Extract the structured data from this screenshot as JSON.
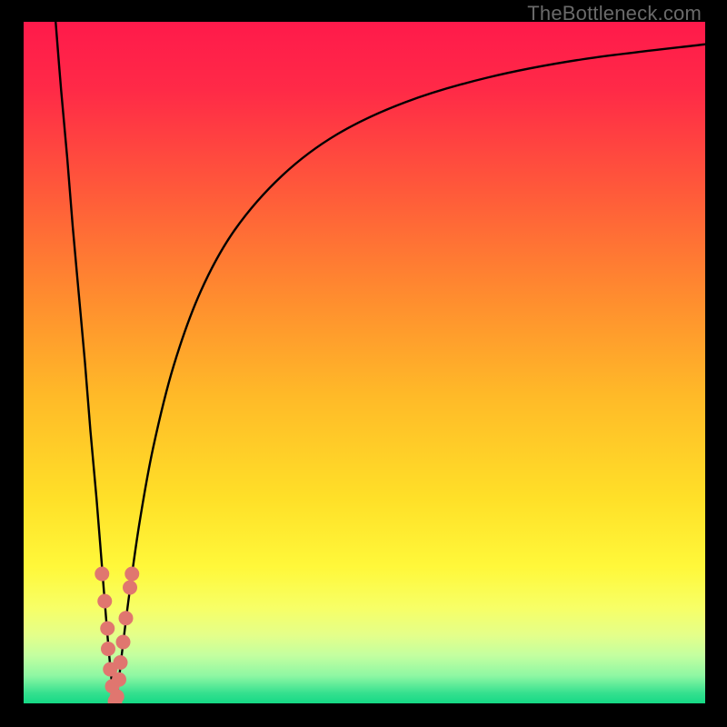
{
  "watermark": "TheBottleneck.com",
  "colors": {
    "frame": "#000000",
    "watermark": "#6a6a6a",
    "curve": "#000000",
    "dots": "#e0766f",
    "gradient_stops": [
      {
        "offset": 0.0,
        "color": "#ff1a4b"
      },
      {
        "offset": 0.1,
        "color": "#ff2a47"
      },
      {
        "offset": 0.25,
        "color": "#ff5a3a"
      },
      {
        "offset": 0.4,
        "color": "#ff8b2f"
      },
      {
        "offset": 0.55,
        "color": "#ffba28"
      },
      {
        "offset": 0.7,
        "color": "#ffe028"
      },
      {
        "offset": 0.8,
        "color": "#fff83a"
      },
      {
        "offset": 0.86,
        "color": "#f7ff66"
      },
      {
        "offset": 0.9,
        "color": "#e4ff8a"
      },
      {
        "offset": 0.93,
        "color": "#c3ffa0"
      },
      {
        "offset": 0.96,
        "color": "#8df7a3"
      },
      {
        "offset": 0.985,
        "color": "#35e08f"
      },
      {
        "offset": 1.0,
        "color": "#15d985"
      }
    ]
  },
  "chart_data": {
    "type": "line",
    "title": "",
    "xlabel": "",
    "ylabel": "",
    "xlim": [
      0,
      100
    ],
    "ylim": [
      0,
      100
    ],
    "curve_points": [
      {
        "x": 4.7,
        "y": 100.0
      },
      {
        "x": 5.5,
        "y": 90.0
      },
      {
        "x": 6.4,
        "y": 80.0
      },
      {
        "x": 7.2,
        "y": 70.0
      },
      {
        "x": 8.1,
        "y": 60.0
      },
      {
        "x": 9.0,
        "y": 50.0
      },
      {
        "x": 9.8,
        "y": 40.0
      },
      {
        "x": 10.7,
        "y": 30.0
      },
      {
        "x": 11.5,
        "y": 20.0
      },
      {
        "x": 12.3,
        "y": 10.0
      },
      {
        "x": 13.0,
        "y": 2.5
      },
      {
        "x": 13.4,
        "y": 0.2
      },
      {
        "x": 13.8,
        "y": 2.0
      },
      {
        "x": 14.5,
        "y": 8.0
      },
      {
        "x": 15.5,
        "y": 16.0
      },
      {
        "x": 17.0,
        "y": 26.5
      },
      {
        "x": 19.0,
        "y": 37.5
      },
      {
        "x": 22.0,
        "y": 49.5
      },
      {
        "x": 26.0,
        "y": 60.5
      },
      {
        "x": 31.0,
        "y": 69.5
      },
      {
        "x": 38.0,
        "y": 77.5
      },
      {
        "x": 46.0,
        "y": 83.5
      },
      {
        "x": 56.0,
        "y": 88.2
      },
      {
        "x": 68.0,
        "y": 91.8
      },
      {
        "x": 82.0,
        "y": 94.5
      },
      {
        "x": 100.0,
        "y": 96.7
      }
    ],
    "series": [
      {
        "name": "markers",
        "points": [
          {
            "x": 11.5,
            "y": 19.0
          },
          {
            "x": 11.9,
            "y": 15.0
          },
          {
            "x": 12.3,
            "y": 11.0
          },
          {
            "x": 12.4,
            "y": 8.0
          },
          {
            "x": 12.7,
            "y": 5.0
          },
          {
            "x": 13.0,
            "y": 2.5
          },
          {
            "x": 13.4,
            "y": 0.3
          },
          {
            "x": 13.7,
            "y": 1.0
          },
          {
            "x": 14.0,
            "y": 3.5
          },
          {
            "x": 14.2,
            "y": 6.0
          },
          {
            "x": 14.6,
            "y": 9.0
          },
          {
            "x": 15.0,
            "y": 12.5
          },
          {
            "x": 15.6,
            "y": 17.0
          },
          {
            "x": 15.9,
            "y": 19.0
          }
        ]
      }
    ]
  }
}
